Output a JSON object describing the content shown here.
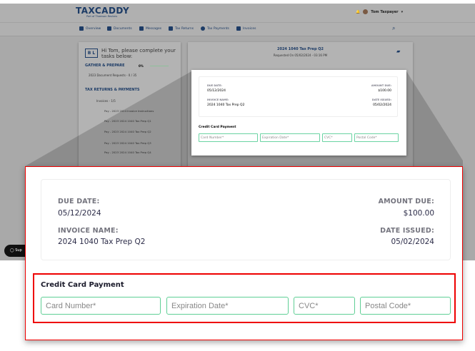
{
  "header": {
    "logo": "TAXCADDY",
    "logo_sub": "Part of Thomson Reuters",
    "user_name": "Tom Taxpayer"
  },
  "nav": [
    {
      "label": "Overview",
      "icon": "home-icon"
    },
    {
      "label": "Documents",
      "icon": "documents-icon"
    },
    {
      "label": "Messages",
      "icon": "messages-icon"
    },
    {
      "label": "Tax Returns",
      "icon": "tax-returns-icon"
    },
    {
      "label": "Tax Payments",
      "icon": "dollar-icon"
    },
    {
      "label": "Invoices",
      "icon": "invoice-icon"
    }
  ],
  "tasks": {
    "badge": "B L",
    "greeting": "Hi Tom, please complete your tasks below:",
    "gather": "GATHER & PREPARE",
    "gather_pct": "0%",
    "doc_requests": "2023 Document Requests - 0 / 35",
    "returns": "TAX RETURNS & PAYMENTS",
    "invoices": "Invoices - 1/5",
    "items": [
      "Pay - 2023 2024 Invoice Instructions",
      "Pay - 2023 2024 1040 Tax Prep Q1",
      "Pay - 2023 2024 1040 Tax Prep Q2",
      "Pay - 2023 2024 1040 Tax Prep Q3",
      "Pay - 2023 2024 1040 Tax Prep Q4"
    ]
  },
  "invoice": {
    "title": "2024 1040 Tax Prep Q2",
    "requested": "Requested On 05/02/2024 - 03:16 PM",
    "due_label": "DUE DATE:",
    "due": "05/12/2024",
    "name_label": "INVOICE NAME:",
    "name": "2024 1040 Tax Prep Q2",
    "amount_label": "AMOUNT DUE:",
    "amount": "$100.00",
    "issued_label": "DATE ISSUED:",
    "issued": "05/02/2024"
  },
  "payment": {
    "title": "Credit Card Payment",
    "card": "Card Number*",
    "exp": "Expiration Date*",
    "cvc": "CVC*",
    "postal": "Postal Code*"
  },
  "support": "Sup",
  "colors": {
    "accent": "#1c3b66",
    "field_border": "#5fcf95",
    "highlight": "#ee0000"
  }
}
